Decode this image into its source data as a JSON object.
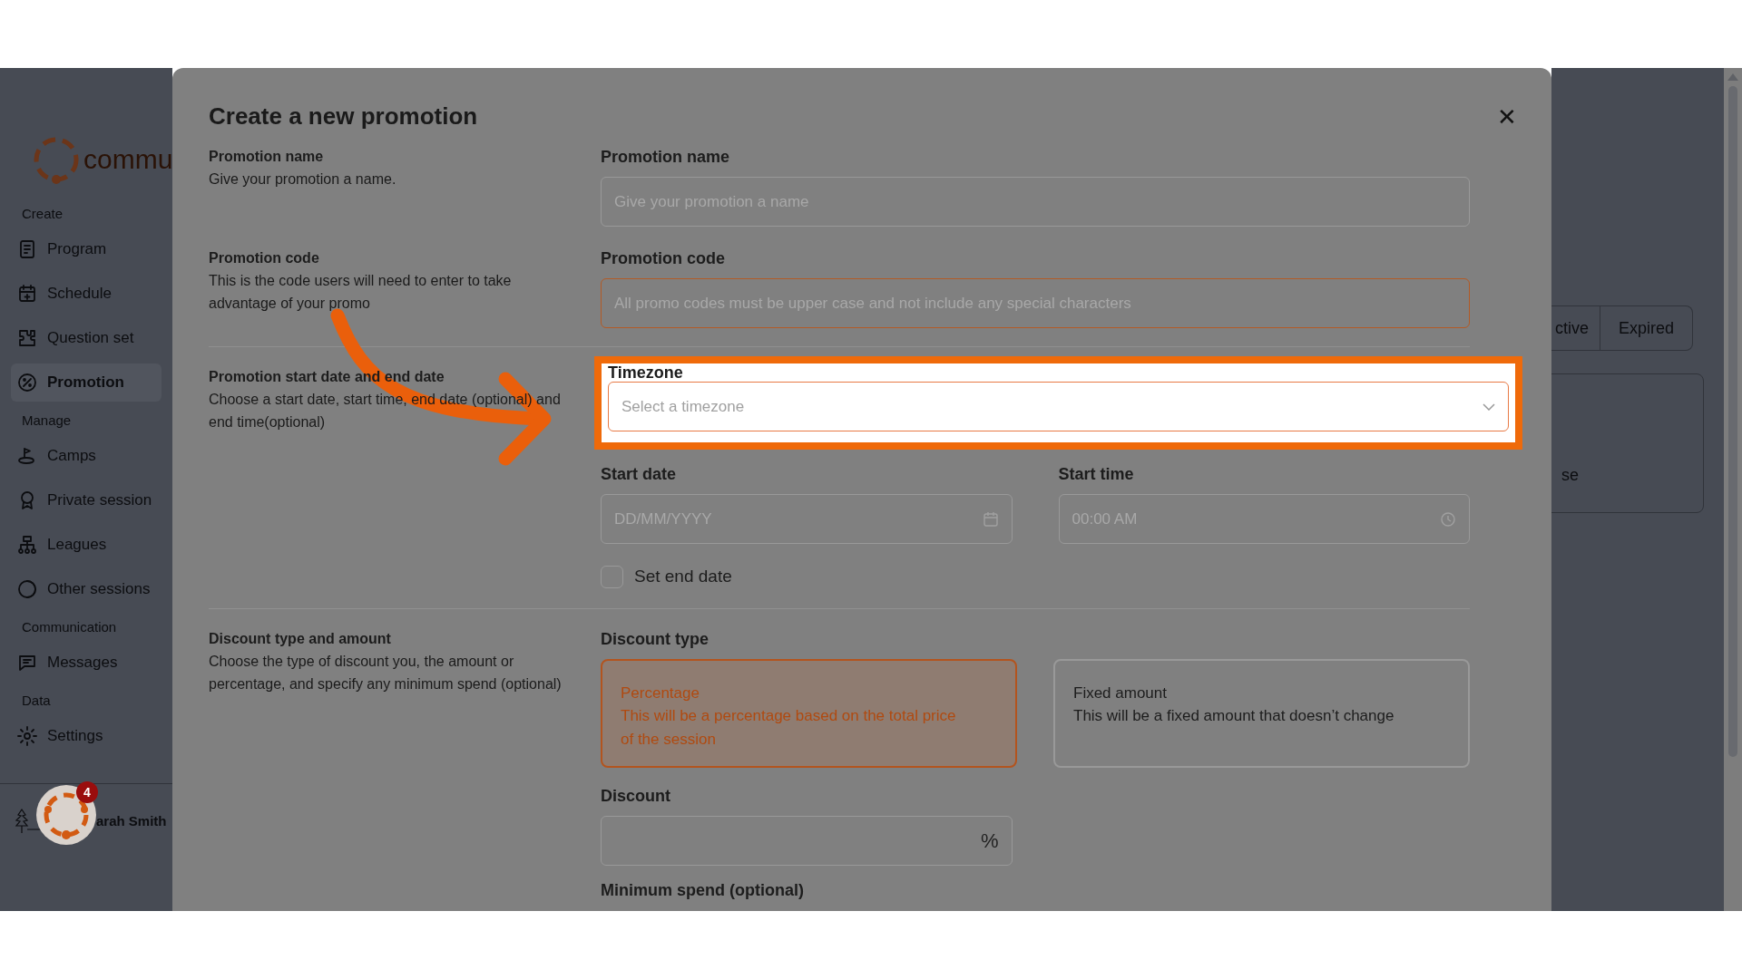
{
  "sidebar": {
    "logo_text": "commu",
    "sections": [
      {
        "heading": "Create",
        "items": [
          {
            "label": "Program",
            "selected": false
          },
          {
            "label": "Schedule",
            "selected": false
          },
          {
            "label": "Question set",
            "selected": false
          },
          {
            "label": "Promotion",
            "selected": true
          }
        ]
      },
      {
        "heading": "Manage",
        "items": [
          {
            "label": "Camps",
            "selected": false
          },
          {
            "label": "Private session",
            "selected": false
          },
          {
            "label": "Leagues",
            "selected": false
          },
          {
            "label": "Other sessions",
            "selected": false
          }
        ]
      },
      {
        "heading": "Communication",
        "items": [
          {
            "label": "Messages",
            "selected": false
          }
        ]
      },
      {
        "heading": "Data",
        "items": [
          {
            "label": "Settings",
            "selected": false
          }
        ]
      }
    ],
    "user_name": "arah Smith"
  },
  "notification_count": "4",
  "background": {
    "tabs": [
      "ctive",
      "Expired"
    ],
    "card_text": "se"
  },
  "modal": {
    "title": "Create a new promotion",
    "close": "✕",
    "sections": [
      {
        "heading": "Promotion name",
        "description": "Give your promotion a name.",
        "fields": [
          {
            "kind": "text",
            "label": "Promotion name",
            "placeholder": "Give your promotion a name",
            "focused": false
          }
        ]
      },
      {
        "heading": "Promotion code",
        "description": "This is the code users will need to enter to take advantage of your promo",
        "fields": [
          {
            "kind": "text",
            "label": "Promotion code",
            "placeholder": "All promo codes must be upper case and not include any special characters",
            "focused": true
          }
        ]
      },
      {
        "heading": "Promotion start date and end date",
        "description": "Choose a start date, start time, end date (optional) and end time(optional)",
        "fields": [
          {
            "kind": "select",
            "label": "Timezone",
            "placeholder": "Select a timezone",
            "highlighted": true
          },
          {
            "kind": "datetime",
            "date_label": "Start date",
            "date_placeholder": "DD/MM/YYYY",
            "time_label": "Start time",
            "time_placeholder": "00:00 AM"
          },
          {
            "kind": "checkbox",
            "label": "Set end date",
            "checked": false
          }
        ]
      },
      {
        "heading": "Discount type and amount",
        "description": "Choose the type of discount you, the amount or percentage, and specify any minimum spend (optional)",
        "fields": [
          {
            "kind": "choice",
            "label": "Discount type",
            "options": [
              {
                "title": "Percentage",
                "description": "This will be a percentage based on the total price of the session",
                "selected": true
              },
              {
                "title": "Fixed amount",
                "description": "This will be a fixed amount that doesn’t change",
                "selected": false
              }
            ]
          },
          {
            "kind": "amount",
            "label": "Discount",
            "suffix": "%"
          },
          {
            "kind": "label",
            "label": "Minimum spend (optional)"
          }
        ]
      }
    ]
  }
}
